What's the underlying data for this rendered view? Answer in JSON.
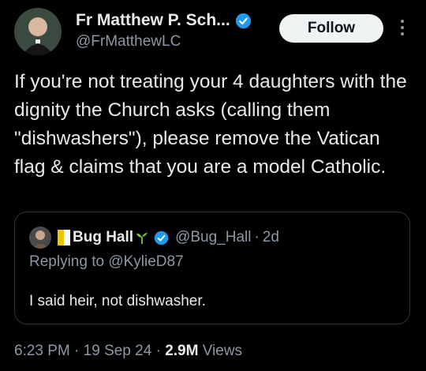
{
  "author": {
    "display_name": "Fr Matthew P. Sch...",
    "handle": "@FrMatthewLC"
  },
  "follow_label": "Follow",
  "tweet_text": "If you're not treating your 4 daughters with the dignity the Church asks (calling them \"dishwashers\"), please remove the Vatican flag & claims that you are a model Catholic.",
  "quoted": {
    "display_name": "Bug Hall",
    "handle": "@Bug_Hall",
    "separator": "·",
    "time_ago": "2d",
    "replying_to": "Replying to @KylieD87",
    "text": "I said heir, not dishwasher."
  },
  "meta": {
    "time": "6:23 PM",
    "sep1": "·",
    "date": "19 Sep 24",
    "sep2": "·",
    "views_count": "2.9M",
    "views_label": "Views"
  },
  "colors": {
    "background": "#000000",
    "primary_text": "#e7e9ea",
    "secondary_text": "#8b98a5",
    "verified_blue": "#1d9bf0",
    "border": "#2f3336"
  }
}
